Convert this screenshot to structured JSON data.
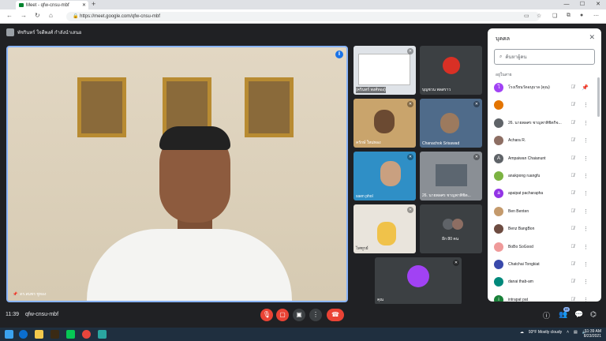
{
  "browser": {
    "tab_title": "Meet - qfw-cnsu-mbf",
    "url": "https://meet.google.com/qfw-cnsu-mbf"
  },
  "meet": {
    "presenter_name": "พัชรินทร์ ใจดีพงศ์ กำลังนำเสนอ",
    "main_speaker": "ดร.สมพร ชูทอง",
    "tiles": [
      {
        "name": "(ครินทร์ พงศ์ทอง)"
      },
      {
        "name": "บุญชวน พลสราว"
      },
      {
        "name": "ครักษ์ ใหม่ทอง"
      },
      {
        "name": "Chanachok Srisawad"
      },
      {
        "name": "saen phol"
      },
      {
        "name": "26. นายพลศร ชาญพาพิชิต..."
      },
      {
        "name": "ไพฑูรย์"
      },
      {
        "name": "อีก 80 คน"
      },
      {
        "name": "คุณ"
      }
    ]
  },
  "people_panel": {
    "title": "บุคคล",
    "search_placeholder": "ค้นหาผู้คน",
    "section_label": "อยู่ในสาย",
    "people": [
      {
        "name": "โรงเรียนวัดอนุบาล (คุณ)",
        "avatar": "โ",
        "color": "#a142f4"
      },
      {
        "name": "",
        "avatar": "",
        "color": "#e37400"
      },
      {
        "name": "26. นายพลศร ชาญพาพิชิตกิจ...",
        "avatar": "",
        "color": "#5f6368"
      },
      {
        "name": "Achara R.",
        "avatar": "",
        "color": "#8d6e63"
      },
      {
        "name": "Ampaiwan Chaianunt",
        "avatar": "A",
        "color": "#5f6368"
      },
      {
        "name": "anakpong ruangfu",
        "avatar": "",
        "color": "#7cb342"
      },
      {
        "name": "apaipat pacharapha",
        "avatar": "a",
        "color": "#9334e6"
      },
      {
        "name": "Ben Benten",
        "avatar": "",
        "color": "#c49a6c"
      },
      {
        "name": "Benz BangBon",
        "avatar": "",
        "color": "#6d4c41"
      },
      {
        "name": "BoBo SoGood",
        "avatar": "",
        "color": "#ef9a9a"
      },
      {
        "name": "Chatchai Tongkiat",
        "avatar": "",
        "color": "#3949ab"
      },
      {
        "name": "danai thab-am",
        "avatar": "",
        "color": "#00897b"
      },
      {
        "name": "intrapat pat",
        "avatar": "i",
        "color": "#188038"
      }
    ]
  },
  "bottom": {
    "time": "11:39",
    "meeting_code": "qfw-cnsu-mbf",
    "people_count": "89"
  },
  "taskbar": {
    "weather": "93°F  Mostly cloudy",
    "clock_time": "11:39 AM",
    "clock_date": "8/23/2021"
  }
}
